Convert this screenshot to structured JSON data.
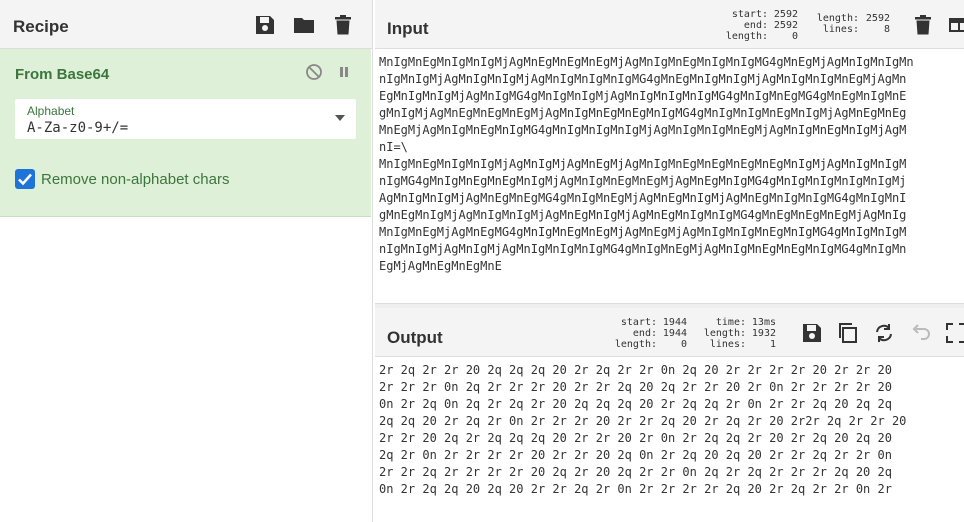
{
  "recipe": {
    "title": "Recipe",
    "operation": {
      "name": "From Base64",
      "alphabet_label": "Alphabet",
      "alphabet_value": "A-Za-z0-9+/=",
      "remove_label": "Remove non-alphabet chars",
      "remove_checked": true
    }
  },
  "input": {
    "title": "Input",
    "stats": {
      "start_label": "start:",
      "start": "2592",
      "end_label": "end:",
      "end": "2592",
      "length_label": "length:",
      "sel_length": "0",
      "total_length_label": "length:",
      "total_length": "2592",
      "lines_label": "lines:",
      "lines": "8"
    },
    "lines": [
      "MnIgMnEgMnIgMnIgMjAgMnEgMnEgMnEgMjAgMnIgMnEgMnIgMnIgMG4gMnEgMjAgMnIgMnIgMn",
      "nIgMnIgMjAgMnIgMnIgMjAgMnIgMnIgMnIgMG4gMnEgMnIgMnIgMjAgMnIgMnIgMnEgMjAgMn",
      "EgMnIgMnIgMjAgMnIgMG4gMnIgMnIgMjAgMnIgMnIgMnIgMG4gMnIgMnEgMG4gMnEgMnIgMnE",
      "gMnIgMjAgMnEgMnEgMnEgMjAgMnIgMnEgMnEgMnIgMG4gMnIgMnIgMnEgMnIgMjAgMnEgMnEg",
      "MnEgMjAgMnIgMnEgMnIgMG4gMnIgMnIgMnIgMjAgMnIgMnIgMnEgMjAgMnIgMnEgMnIgMjAgM",
      "nI=\\",
      "MnIgMnEgMnIgMnIgMjAgMnIgMjAgMnEgMjAgMnIgMnEgMnEgMnEgMnEgMnIgMjAgMnIgMnIgM",
      "nIgMG4gMnIgMnEgMnEgMnIgMjAgMnIgMnEgMnEgMjAgMnEgMnIgMG4gMnIgMnIgMnIgMnIgMj",
      "AgMnIgMnIgMjAgMnEgMnEgMG4gMnIgMnEgMjAgMnEgMnIgMjAgMnEgMnIgMnIgMG4gMnIgMnI",
      "gMnEgMnIgMjAgMnIgMnIgMjAgMnEgMnIgMjAgMnEgMnIgMnIgMG4gMnEgMnEgMnEgMjAgMnIg",
      "MnIgMnEgMjAgMnEgMG4gMnIgMnEgMnEgMjAgMnEgMjAgMnIgMnIgMnEgMnIgMG4gMnIgMnIgM",
      "nIgMnIgMjAgMnIgMjAgMnIgMnIgMnIgMG4gMnIgMnEgMjAgMnIgMnEgMnEgMnIgMG4gMnIgMn",
      "EgMjAgMnEgMnEgMnE"
    ]
  },
  "output": {
    "title": "Output",
    "stats": {
      "start_label": "start:",
      "start": "1944",
      "end_label": "end:",
      "end": "1944",
      "length_label": "length:",
      "sel_length": "0",
      "time_label": "time:",
      "time": "13ms",
      "total_length_label": "length:",
      "total_length": "1932",
      "lines_label": "lines:",
      "lines": "1"
    },
    "lines": [
      "2r 2q 2r 2r 20 2q 2q 2q 20 2r 2q 2r 2r 0n 2q 20 2r 2r 2r 2r 20 2r 2r 20",
      "2r 2r 2r 0n 2q 2r 2r 2r 20 2r 2r 2q 20 2q 2r 2r 20 2r 0n 2r 2r 2r 2r 20",
      "0n 2r 2q 0n 2q 2r 2q 2r 20 2q 2q 2q 20 2r 2q 2q 2r 0n 2r 2r 2q 20 2q 2q",
      "2q 2q 20 2r 2q 2r 0n 2r 2r 2r 20 2r 2r 2q 20 2r 2q 2r 20 2r2r 2q 2r 2r 20",
      "2r 2r 20 2q 2r 2q 2q 2q 20 2r 2r 20 2r 0n 2r 2q 2q 2r 20 2r 2q 20 2q 20",
      "2q 2r 0n 2r 2r 2r 2r 20 2r 2r 20 2q 0n 2r 2q 20 2q 20 2r 2r 2q 2r 2r 0n",
      "2r 2r 2q 2r 2r 2r 2r 20 2q 2r 20 2q 2r 2r 0n 2q 2r 2q 2r 2r 2r 2q 20 2q",
      "0n 2r 2q 2q 20 2q 20 2r 2r 2q 2r 0n 2r 2r 2r 2r 2q 20 2r 2q 2r 2r 0n 2r"
    ]
  },
  "icons": {
    "save": "save-icon",
    "folder": "folder-icon",
    "trash": "trash-icon",
    "disable": "disable-icon",
    "pause": "pause-icon",
    "layout": "layout-icon",
    "copy": "copy-icon",
    "replace": "replace-input-icon",
    "undo": "undo-icon",
    "maximize": "maximize-icon",
    "check": "check-icon",
    "caret": "caret-down-icon"
  },
  "colors": {
    "operation_bg": "#dff0d8",
    "operation_text": "#3c763d",
    "checkbox": "#1e73d8",
    "header_bg": "#f4f4f4"
  }
}
